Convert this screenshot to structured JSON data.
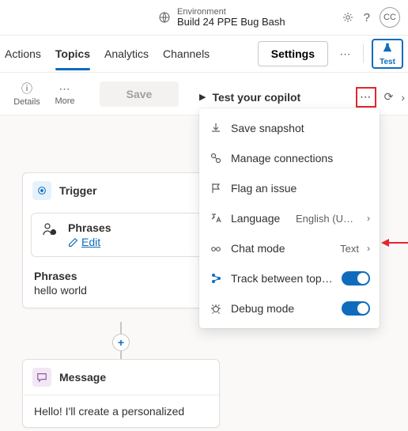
{
  "header": {
    "env_label": "Environment",
    "env_name": "Build 24 PPE Bug Bash",
    "avatar_initials": "CC"
  },
  "tabs": {
    "actions": "Actions",
    "topics": "Topics",
    "analytics": "Analytics",
    "channels": "Channels",
    "active": "topics"
  },
  "bar": {
    "settings": "Settings",
    "test": "Test"
  },
  "toolbar": {
    "details": "Details",
    "more": "More",
    "save": "Save"
  },
  "test_panel": {
    "title": "Test your copilot"
  },
  "menu": {
    "save_snapshot": "Save snapshot",
    "manage_connections": "Manage connections",
    "flag_issue": "Flag an issue",
    "language": "Language",
    "language_value": "English (United ...",
    "chat_mode": "Chat mode",
    "chat_mode_value": "Text",
    "track_between_topics": "Track between topics",
    "debug_mode": "Debug mode",
    "track_on": true,
    "debug_on": true
  },
  "canvas": {
    "trigger": {
      "title": "Trigger",
      "phrases_label": "Phrases",
      "edit_label": "Edit",
      "phrases_body_label": "Phrases",
      "phrases_value": "hello world"
    },
    "message": {
      "title": "Message",
      "body": "Hello! I'll create a personalized"
    }
  }
}
